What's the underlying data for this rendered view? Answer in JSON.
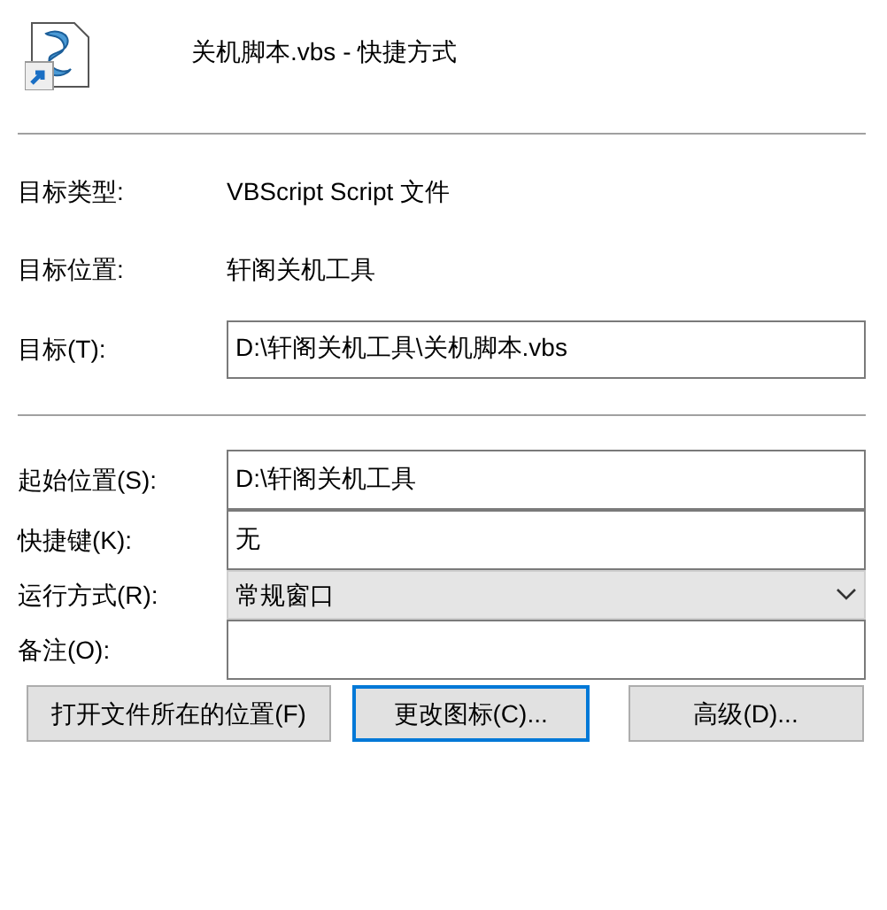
{
  "header": {
    "title": "关机脚本.vbs - 快捷方式"
  },
  "info": [
    {
      "label": "目标类型:",
      "value": "VBScript Script 文件"
    },
    {
      "label": "目标位置:",
      "value": "轩阁关机工具"
    }
  ],
  "target": {
    "label": "目标(T):",
    "value": "D:\\轩阁关机工具\\关机脚本.vbs"
  },
  "fields": [
    {
      "kind": "text",
      "label": "起始位置(S):",
      "value": "D:\\轩阁关机工具"
    },
    {
      "kind": "text",
      "label": "快捷键(K):",
      "value": "无"
    },
    {
      "kind": "dropdown",
      "label": "运行方式(R):",
      "value": "常规窗口"
    },
    {
      "kind": "text",
      "label": "备注(O):"
    }
  ],
  "buttons": [
    {
      "label": "打开文件所在的位置(F)",
      "focused": false
    },
    {
      "label": "更改图标(C)...",
      "focused": true
    },
    {
      "label": "高级(D)...",
      "focused": false
    }
  ]
}
